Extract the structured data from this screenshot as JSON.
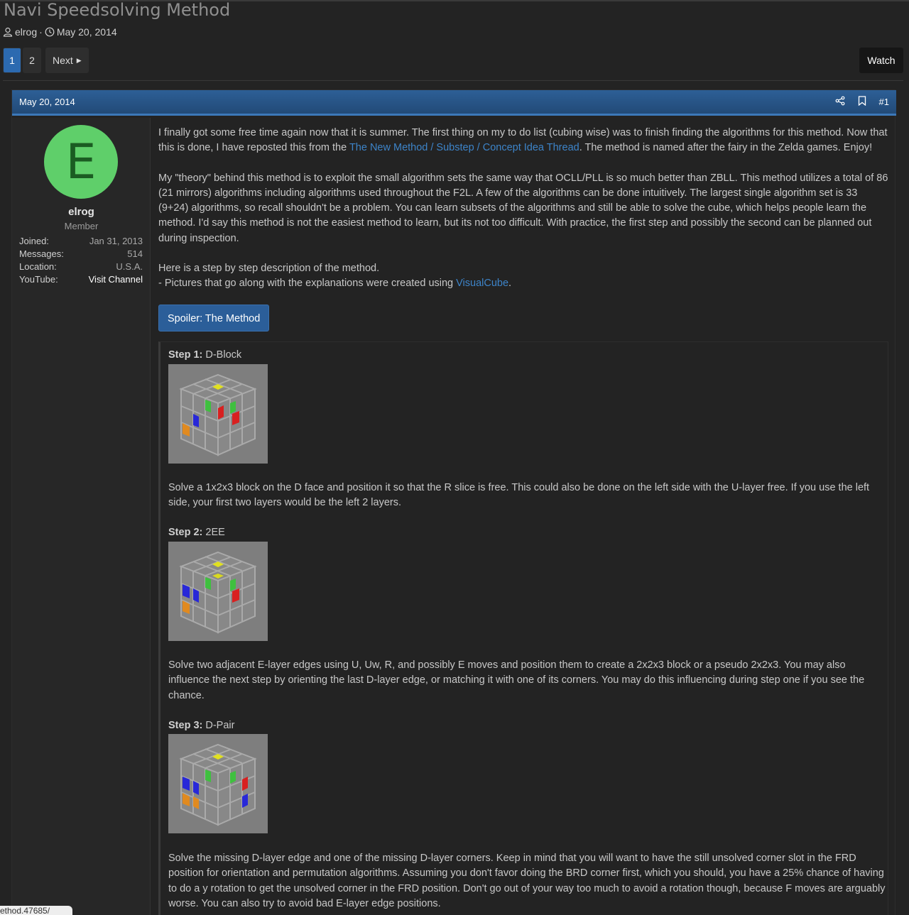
{
  "thread": {
    "title": "Navi Speedsolving Method",
    "author": "elrog",
    "date": "May 20, 2014"
  },
  "pagination": {
    "pages": [
      "1",
      "2"
    ],
    "current": "1",
    "next_label": "Next"
  },
  "watch_label": "Watch",
  "post": {
    "date": "May 20, 2014",
    "number": "#1",
    "user": {
      "avatar_letter": "E",
      "name": "elrog",
      "role": "Member",
      "stats": [
        {
          "label": "Joined:",
          "value": "Jan 31, 2013"
        },
        {
          "label": "Messages:",
          "value": "514"
        },
        {
          "label": "Location:",
          "value": "U.S.A."
        },
        {
          "label": "YouTube:",
          "value": "Visit Channel"
        }
      ]
    },
    "p1_a": "I finally got some free time again now that it is summer. The first thing on my to do list (cubing wise) was to finish finding the algorithms for this method. Now that this is done, I have reposted this from the ",
    "p1_link": "The New Method / Substep / Concept Idea Thread",
    "p1_b": ". The method is named after the fairy in the Zelda games. Enjoy!",
    "p2": "My \"theory\" behind this method is to exploit the small algorithm sets the same way that OCLL/PLL is so much better than ZBLL. This method utilizes a total of 86 (21 mirrors) algorithms including algorithms used throughout the F2L. A few of the algorithms can be done intuitively. The largest single algorithm set is 33 (9+24) algorithms, so recall shouldn't be a problem. You can learn subsets of the algorithms and still be able to solve the cube, which helps people learn the method. I'd say this method is not the easiest method to learn, but its not too difficult. With practice, the first step and possibly the second can be planned out during inspection.",
    "p3_line1": "Here is a step by step description of the method.",
    "p3_line2_a": "- Pictures that go along with the explanations were created using ",
    "p3_link": "VisualCube",
    "p3_line2_b": ".",
    "spoiler_label": "Spoiler: The Method",
    "steps": [
      {
        "label": "Step 1:",
        "name": "D-Block",
        "desc": "Solve a 1x2x3 block on the D face and position it so that the R slice is free. This could also be done on the left side with the U-layer free. If you use the left side, your first two layers would be the left 2 layers."
      },
      {
        "label": "Step 2:",
        "name": "2EE",
        "desc": "Solve two adjacent E-layer edges using U, Uw, R, and possibly E moves and position them to create a 2x2x3 block or a pseudo 2x2x3. You may also influence the next step by orienting the last D-layer edge, or matching it with one of its corners. You may do this influencing during step one if you see the chance."
      },
      {
        "label": "Step 3:",
        "name": "D-Pair",
        "desc": "Solve the missing D-layer edge and one of the missing D-layer corners. Keep in mind that you will want to have the still unsolved corner slot in the FRD position for orientation and permutation algorithms. Assuming you don't favor doing the BRD corner first, which you should, you have a 25% chance of having to do a y rotation to get the unsolved corner in the FRD position. Don't go out of your way too much to avoid a rotation though, because F moves are arguably worse. You can also try to avoid bad E-layer edge positions."
      }
    ]
  },
  "status_url": "ethod.47685/"
}
